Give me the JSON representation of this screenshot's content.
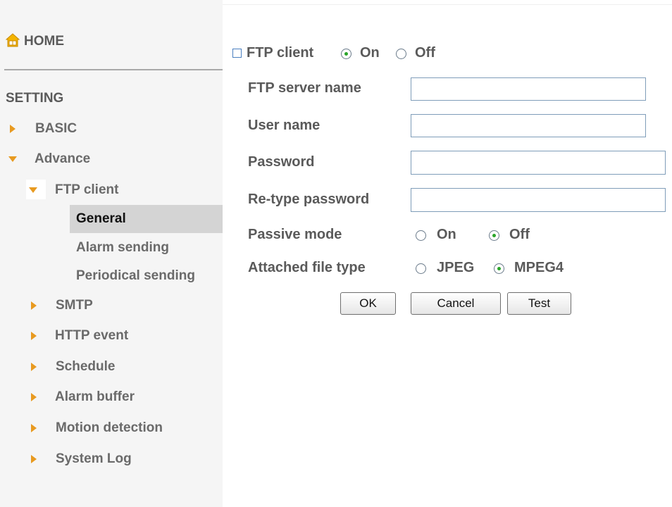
{
  "sidebar": {
    "home_label": "HOME",
    "setting_label": "SETTING",
    "basic_label": "BASIC",
    "advance_label": "Advance",
    "ftp_label": "FTP client",
    "ftp_sub": [
      "General",
      "Alarm sending",
      "Periodical sending"
    ],
    "items": [
      "SMTP",
      "HTTP event",
      "Schedule",
      "Alarm buffer",
      "Motion detection",
      "System Log"
    ]
  },
  "form": {
    "ftp_client_label": "FTP client",
    "on_label": "On",
    "off_label": "Off",
    "ftp_client_value": "On",
    "server_name_label": "FTP server name",
    "server_name_value": "",
    "user_name_label": "User name",
    "user_name_value": "",
    "password_label": "Password",
    "password_value": "",
    "retype_label": "Re-type password",
    "retype_value": "",
    "passive_label": "Passive mode",
    "passive_value": "Off",
    "file_type_label": "Attached file type",
    "jpeg_label": "JPEG",
    "mpeg4_label": "MPEG4",
    "file_type_value": "MPEG4"
  },
  "buttons": {
    "ok": "OK",
    "cancel": "Cancel",
    "test": "Test"
  },
  "colors": {
    "accent_arrow": "#e89a20",
    "highlight": "#d4d4d4",
    "radio_dot": "#2aa52a"
  }
}
